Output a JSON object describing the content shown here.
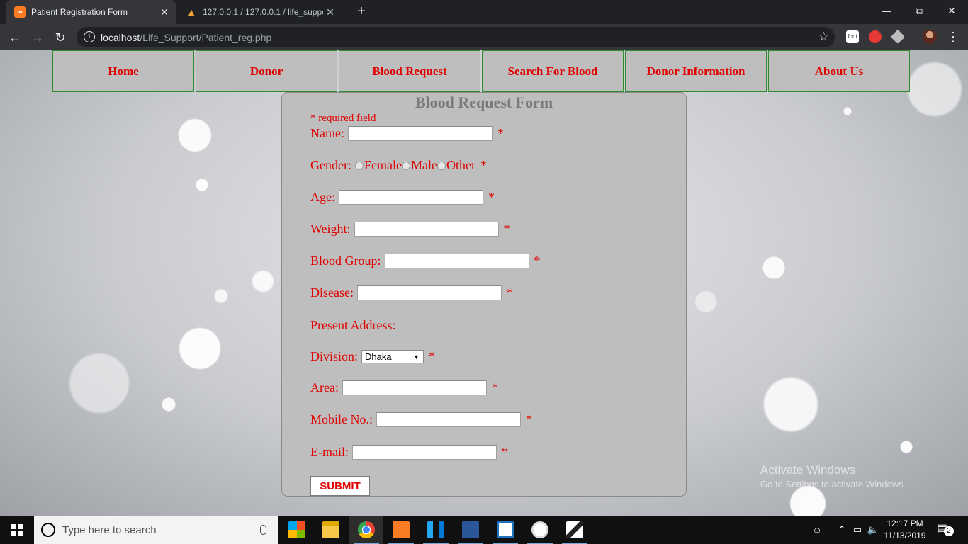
{
  "browser": {
    "tabs": [
      {
        "title": "Patient Registration Form",
        "active": true,
        "icon": "xampp-icon"
      },
      {
        "title": "127.0.0.1 / 127.0.0.1 / life_suppor",
        "active": false,
        "icon": "phpmyadmin-icon"
      }
    ],
    "url_host": "localhost",
    "url_path": "/Life_Support/Patient_reg.php",
    "extensions": [
      "font-extension-icon",
      "stop-extension-icon",
      "cube-extension-icon"
    ],
    "ext_font_label": "font"
  },
  "nav": {
    "items": [
      "Home",
      "Donor",
      "Blood Request",
      "Search For Blood",
      "Donor Information",
      "About Us"
    ]
  },
  "form": {
    "title": "Blood Request Form",
    "required_note": "* required field",
    "asterisk": "*",
    "name_label": "Name:",
    "gender_label": "Gender:",
    "gender_options": [
      "Female",
      "Male",
      "Other"
    ],
    "age_label": "Age:",
    "weight_label": "Weight:",
    "blood_group_label": "Blood Group:",
    "disease_label": "Disease:",
    "present_address_label": "Present Address:",
    "division_label": "Division:",
    "division_value": "Dhaka",
    "area_label": "Area:",
    "mobile_label": "Mobile No.:",
    "email_label": "E-mail:",
    "submit_label": "SUBMIT"
  },
  "watermark": {
    "line1": "Activate Windows",
    "line2": "Go to Settings to activate Windows."
  },
  "taskbar": {
    "search_placeholder": "Type here to search",
    "time": "12:17 PM",
    "date": "11/13/2019",
    "notification_count": "2",
    "apps": [
      "windows-store-icon",
      "file-explorer-icon",
      "chrome-icon",
      "xampp-icon",
      "vscode-icon",
      "word-icon",
      "image-viewer-icon",
      "paint-icon",
      "photos-icon"
    ]
  },
  "colors": {
    "accent_red": "#e00000",
    "panel_gray": "#bebebe",
    "nav_border": "#2e8b2e"
  }
}
